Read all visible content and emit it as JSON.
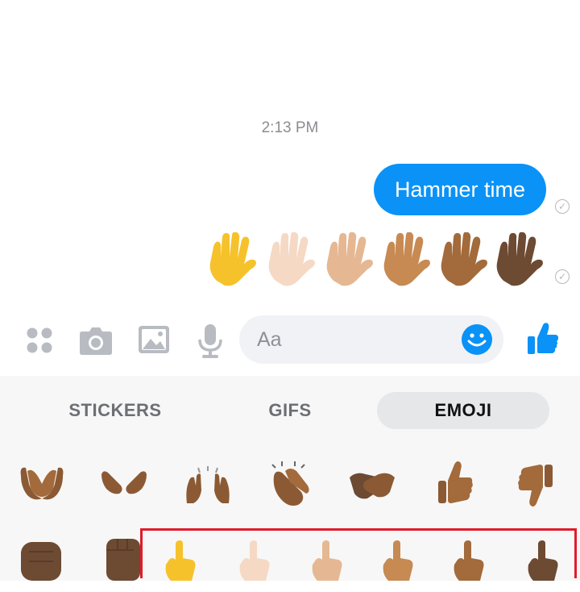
{
  "conversation": {
    "timestamp": "2:13 PM",
    "sent_message": "Hammer time",
    "hand_emojis": [
      "raised-hand-yellow",
      "raised-hand-light",
      "raised-hand-medium-light",
      "raised-hand-medium",
      "raised-hand-medium-dark",
      "raised-hand-dark"
    ]
  },
  "composer": {
    "placeholder": "Aa",
    "icons": [
      "apps-icon",
      "camera-icon",
      "gallery-icon",
      "microphone-icon",
      "emoji-icon",
      "thumbs-up-icon"
    ]
  },
  "picker": {
    "tabs": [
      {
        "label": "STICKERS",
        "selected": false
      },
      {
        "label": "GIFS",
        "selected": false
      },
      {
        "label": "EMOJI",
        "selected": true
      }
    ],
    "row1": [
      "palms-up-together",
      "open-hands",
      "raising-hands",
      "clapping-hands",
      "handshake",
      "thumbs-up",
      "thumbs-down"
    ],
    "row2": [
      "oncoming-fist",
      "raised-fist",
      "point-up-yellow",
      "point-up-light",
      "point-up-medium-light",
      "point-up-medium",
      "point-up-medium-dark",
      "point-up-dark"
    ]
  },
  "colors": {
    "accent": "#0a92f7",
    "highlight_box": "#e01b2a",
    "skin_tones": [
      "#f6c22b",
      "#f5d9c4",
      "#e5b893",
      "#c78a52",
      "#a36a3b",
      "#6d4a32"
    ]
  }
}
